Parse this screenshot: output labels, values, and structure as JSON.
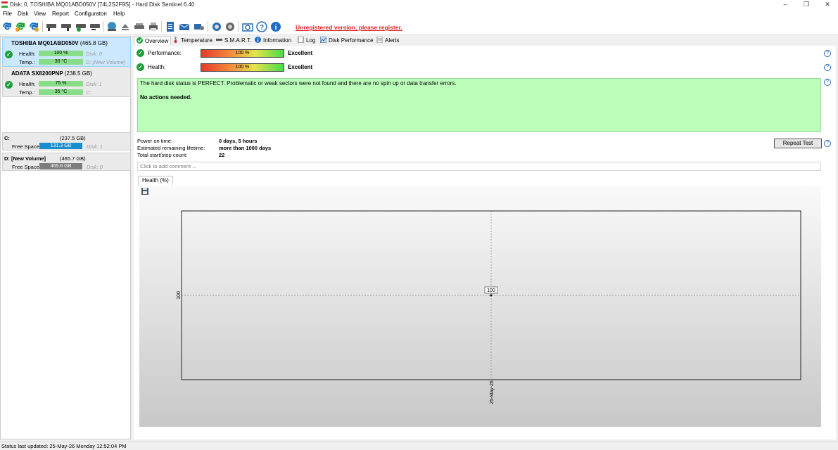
{
  "window": {
    "title": "Disk: 0, TOSHIBA MQ01ABD050V [74L2S2F9S]  -  Hard Disk Sentinel 6.40",
    "controls": {
      "minimize": "–",
      "restore": "❐",
      "close": "✕"
    }
  },
  "menu": {
    "file": "File",
    "disk": "Disk",
    "view": "View",
    "report": "Report",
    "configuration": "Configuraton",
    "help": "Help"
  },
  "toolbar": {
    "registration_notice": "Unregistered version, please register.",
    "icons": [
      "refresh-icon",
      "refresh-all-icon",
      "disk-icon",
      "disk-test-icon",
      "disk-ok-icon",
      "disk-remove-icon",
      "globe-icon",
      "eject-icon",
      "scanner-icon",
      "printer-icon",
      "report-icon",
      "mail-icon",
      "send-icon",
      "settings-icon",
      "alerts-icon",
      "camera-icon",
      "help-icon",
      "info-icon"
    ]
  },
  "disks": [
    {
      "name": "TOSHIBA MQ01ABD050V",
      "size": "(465.8 GB)",
      "health_label": "Health:",
      "health": "100 %",
      "temp_label": "Temp.:",
      "temp": "30 °C",
      "disk_id": "Disk: 0",
      "volume": "D: [New Volume]",
      "selected": true
    },
    {
      "name": "ADATA SX8200PNP",
      "size": "(238.5 GB)",
      "health_label": "Health:",
      "health": "75 %",
      "temp_label": "Temp.:",
      "temp": "35 °C",
      "disk_id": "Disk: 1",
      "volume": "C:",
      "selected": false
    }
  ],
  "volumes": [
    {
      "name": "C:",
      "size": "(237.5 GB)",
      "free_label": "Free Space",
      "free": "131.3 GB",
      "disk": "Disk: 1",
      "bar_color": "#1a8fd0"
    },
    {
      "name": "D: [New Volume]",
      "size": "(465.7 GB)",
      "free_label": "Free Space",
      "free": "465.6 GB",
      "disk": "Disk: 0",
      "bar_color": "#7d7d7d"
    }
  ],
  "tabs": [
    {
      "label": "Overview",
      "icon": "check-icon",
      "active": true
    },
    {
      "label": "Temperature",
      "icon": "thermometer-icon",
      "active": false
    },
    {
      "label": "S.M.A.R.T.",
      "icon": "smart-icon",
      "active": false
    },
    {
      "label": "Information",
      "icon": "info-icon",
      "active": false
    },
    {
      "label": "Log",
      "icon": "log-icon",
      "active": false
    },
    {
      "label": "Disk Performance",
      "icon": "performance-icon",
      "active": false
    },
    {
      "label": "Alerts",
      "icon": "alerts-icon",
      "active": false
    }
  ],
  "overview": {
    "performance_label": "Performance:",
    "performance_value": "100 %",
    "performance_verdict": "Excellent",
    "health_label": "Health:",
    "health_value": "100 %",
    "health_verdict": "Excellent",
    "status_text": "The hard disk status is PERFECT. Problematic or weak sectors were not found and there are no spin up or data transfer errors.",
    "action_text": "No actions needed.",
    "power_on_label": "Power on time:",
    "power_on_value": "0 days, 5 hours",
    "lifetime_label": "Estimated remaining lifetime:",
    "lifetime_value": "more than 1000 days",
    "startstop_label": "Total start/stop count:",
    "startstop_value": "22",
    "repeat_test": "Repeat Test",
    "comment_placeholder": "Click to add comment ...",
    "chart_tab": "Health (%)"
  },
  "chart_data": {
    "type": "line",
    "x": [
      "25-May-26"
    ],
    "series": [
      {
        "values": [
          100
        ]
      }
    ],
    "point_label": "100",
    "ytick": "100",
    "xtick": "25-May-26",
    "grid": true
  },
  "status_bar": "Status last updated: 25-May-26 Monday 12:52:04 PM"
}
